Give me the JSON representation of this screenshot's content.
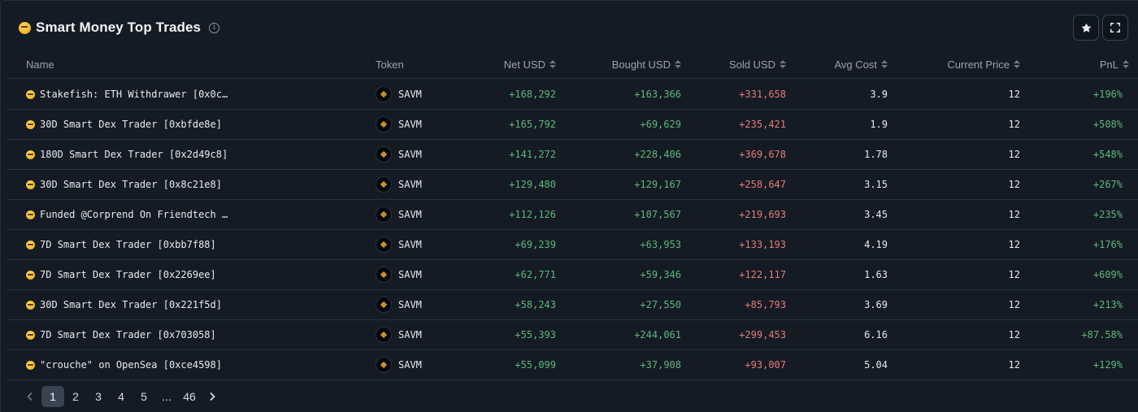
{
  "widget": {
    "title": "Smart Money Top Trades",
    "info_icon": "info-icon",
    "actions": [
      {
        "name": "star-icon"
      },
      {
        "name": "fullscreen-icon"
      }
    ]
  },
  "table": {
    "columns": {
      "name": "Name",
      "token": "Token",
      "net_usd": "Net USD",
      "bought_usd": "Bought USD",
      "sold_usd": "Sold USD",
      "avg_cost": "Avg Cost",
      "current_price": "Current Price",
      "pnl": "PnL"
    },
    "rows": [
      {
        "name": "Stakefish: ETH Withdrawer [0x0c…",
        "token": "SAVM",
        "net_usd": "+168,292",
        "bought_usd": "+163,366",
        "sold_usd": "+331,658",
        "avg_cost": "3.9",
        "current_price": "12",
        "pnl": "+196%"
      },
      {
        "name": "30D Smart Dex Trader [0xbfde8e]",
        "token": "SAVM",
        "net_usd": "+165,792",
        "bought_usd": "+69,629",
        "sold_usd": "+235,421",
        "avg_cost": "1.9",
        "current_price": "12",
        "pnl": "+508%"
      },
      {
        "name": "180D Smart Dex Trader [0x2d49c8]",
        "token": "SAVM",
        "net_usd": "+141,272",
        "bought_usd": "+228,406",
        "sold_usd": "+369,678",
        "avg_cost": "1.78",
        "current_price": "12",
        "pnl": "+548%"
      },
      {
        "name": "30D Smart Dex Trader [0x8c21e8]",
        "token": "SAVM",
        "net_usd": "+129,480",
        "bought_usd": "+129,167",
        "sold_usd": "+258,647",
        "avg_cost": "3.15",
        "current_price": "12",
        "pnl": "+267%"
      },
      {
        "name": "Funded @Corprend On Friendtech …",
        "token": "SAVM",
        "net_usd": "+112,126",
        "bought_usd": "+107,567",
        "sold_usd": "+219,693",
        "avg_cost": "3.45",
        "current_price": "12",
        "pnl": "+235%"
      },
      {
        "name": "7D Smart Dex Trader [0xbb7f88]",
        "token": "SAVM",
        "net_usd": "+69,239",
        "bought_usd": "+63,953",
        "sold_usd": "+133,193",
        "avg_cost": "4.19",
        "current_price": "12",
        "pnl": "+176%"
      },
      {
        "name": "7D Smart Dex Trader [0x2269ee]",
        "token": "SAVM",
        "net_usd": "+62,771",
        "bought_usd": "+59,346",
        "sold_usd": "+122,117",
        "avg_cost": "1.63",
        "current_price": "12",
        "pnl": "+609%"
      },
      {
        "name": "30D Smart Dex Trader [0x221f5d]",
        "token": "SAVM",
        "net_usd": "+58,243",
        "bought_usd": "+27,550",
        "sold_usd": "+85,793",
        "avg_cost": "3.69",
        "current_price": "12",
        "pnl": "+213%"
      },
      {
        "name": "7D Smart Dex Trader [0x703058]",
        "token": "SAVM",
        "net_usd": "+55,393",
        "bought_usd": "+244,061",
        "sold_usd": "+299,453",
        "avg_cost": "6.16",
        "current_price": "12",
        "pnl": "+87.58%"
      },
      {
        "name": "\"crouche\" on OpenSea [0xce4598]",
        "token": "SAVM",
        "net_usd": "+55,099",
        "bought_usd": "+37,908",
        "sold_usd": "+93,007",
        "avg_cost": "5.04",
        "current_price": "12",
        "pnl": "+129%"
      }
    ]
  },
  "pagination": {
    "prev": "‹",
    "pages": [
      "1",
      "2",
      "3",
      "4",
      "5"
    ],
    "ellipsis": "...",
    "last": "46",
    "next": "›",
    "current": "1"
  },
  "colors": {
    "positive": "#5fb878",
    "negative": "#e77b76",
    "background": "#141b24"
  }
}
